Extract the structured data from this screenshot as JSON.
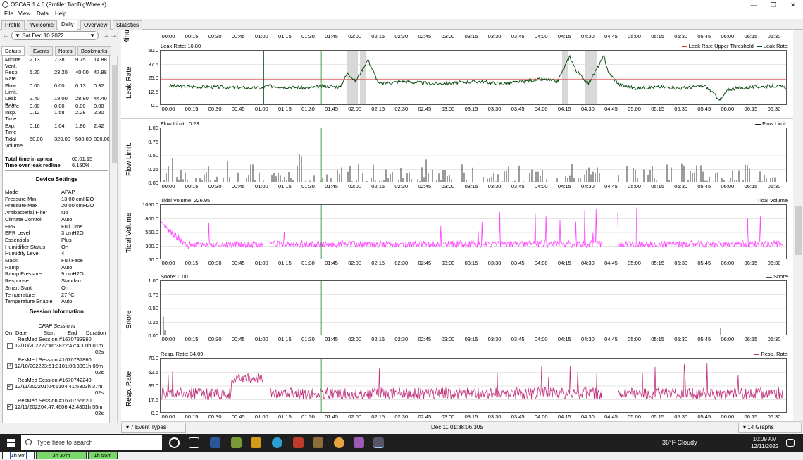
{
  "window": {
    "title": "OSCAR 1.4.0 (Profile: TwoBigWheels)"
  },
  "menu": [
    "File",
    "View",
    "Data",
    "Help"
  ],
  "tabs": [
    "Profile",
    "Welcome",
    "Daily",
    "Overview",
    "Statistics"
  ],
  "nav": {
    "date": "Sat Dec 10 2022",
    "prev": "←",
    "next": "→",
    "last": "→|"
  },
  "subtabs": [
    "Details",
    "Events",
    "Notes",
    "Bookmarks"
  ],
  "stats": [
    {
      "label": "Minute Vent.",
      "v": [
        "2.13",
        "7.38",
        "9.75",
        "14.88"
      ]
    },
    {
      "label": "Resp. Rate",
      "v": [
        "5.20",
        "23.20",
        "40.00",
        "47.88"
      ]
    },
    {
      "label": "Flow Limit.",
      "v": [
        "0.00",
        "0.00",
        "0.13",
        "0.32"
      ]
    },
    {
      "label": "Leak Rate",
      "v": [
        "2.40",
        "18.00",
        "28.80",
        "44.40"
      ]
    },
    {
      "label": "Snore",
      "v": [
        "0.00",
        "0.00",
        "0.00",
        "0.00"
      ]
    },
    {
      "label": "Insp. Time",
      "v": [
        "0.12",
        "1.58",
        "2.28",
        "2.80"
      ]
    },
    {
      "label": "Exp. Time",
      "v": [
        "0.16",
        "1.04",
        "1.86",
        "2.42"
      ]
    },
    {
      "label": "Tidal Volume",
      "v": [
        "60.00",
        "320.00",
        "500.00",
        "800.00"
      ]
    }
  ],
  "totals": [
    {
      "label": "Total time in apnea",
      "value": "00:01:15"
    },
    {
      "label": "Time over leak redline",
      "value": "6.150%"
    }
  ],
  "device_settings_title": "Device Settings",
  "settings": [
    {
      "k": "Mode",
      "v": "APAP"
    },
    {
      "k": "Pressure Min",
      "v": "13.00 cmH2O"
    },
    {
      "k": "Pressure Max",
      "v": "20.00 cmH2O"
    },
    {
      "k": "Antibacterial Filter",
      "v": "No"
    },
    {
      "k": "Climate Control",
      "v": "Auto"
    },
    {
      "k": "EPR",
      "v": "Full Time"
    },
    {
      "k": "EPR Level",
      "v": "3 cmH2O"
    },
    {
      "k": "Essentials",
      "v": "Plus"
    },
    {
      "k": "Humidifier Status",
      "v": "On"
    },
    {
      "k": "Humidity Level",
      "v": "4"
    },
    {
      "k": "Mask",
      "v": "Full Face"
    },
    {
      "k": "Ramp",
      "v": "Auto"
    },
    {
      "k": "Ramp Pressure",
      "v": "9 cmH2O"
    },
    {
      "k": "Response",
      "v": "Standard"
    },
    {
      "k": "Smart Start",
      "v": "On"
    },
    {
      "k": "Temperature",
      "v": "27 ºC"
    },
    {
      "k": "Temperature Enable",
      "v": "Auto"
    }
  ],
  "session_info_title": "Session Information",
  "cpap_sessions_label": "CPAP Sessions",
  "session_headers": [
    "On",
    "Date",
    "Start",
    "End",
    "Duration"
  ],
  "sessions": [
    {
      "name": "ResMed Session #1670733960",
      "line": "12/10/202222:46:3822:47:4000h 01m",
      "sec": "02s",
      "on": false
    },
    {
      "name": "ResMed Session #1670737860",
      "line": "12/10/202223:51:3101:00:3301h 09m",
      "sec": "02s",
      "on": true
    },
    {
      "name": "ResMed Session #1670742240",
      "line": "12/11/202201:04:5104:41:5303h 37m",
      "sec": "02s",
      "on": true
    },
    {
      "name": "ResMed Session #1670755620",
      "line": "12/11/202204:47:4606:42:4801h 55m",
      "sec": "02s",
      "on": true
    }
  ],
  "bottom_segments": [
    "1h 9m",
    "3h 37m",
    "1h 55m"
  ],
  "time_ticks": [
    "00:00",
    "00:15",
    "00:30",
    "00:45",
    "01:00",
    "01:15",
    "01:30",
    "01:45",
    "02:00",
    "02:15",
    "02:30",
    "02:45",
    "03:00",
    "03:15",
    "03:30",
    "03:45",
    "04:00",
    "04:15",
    "04:30",
    "04:45",
    "05:00",
    "05:15",
    "05:30",
    "05:45",
    "06:00",
    "06:15",
    "06:30"
  ],
  "cursor_time": "Dec 11 01:38:06.305",
  "event_types": "7 Event Types",
  "graph_count": "14 Graphs",
  "minu_label": "Minu",
  "colors": {
    "leak": "#0e4d12",
    "flow": "#222222",
    "tidal": "#ff44ff",
    "snore": "#444444",
    "resp": "#c0307a",
    "threshold": "#e04040",
    "cursor": "#1a8a1a",
    "shade": "#d8d8d8"
  },
  "chart_data": [
    {
      "type": "line",
      "title": "Leak Rate: 16.80",
      "ylabel": "Leak Rate",
      "ylim": [
        0,
        50
      ],
      "yticks": [
        "50.0",
        "37.5",
        "25.0",
        "12.5",
        "0.0"
      ],
      "legend": [
        "Leak Rate Upper Threshold",
        "Leak Rate"
      ],
      "threshold": 24,
      "x": [
        0,
        60,
        63,
        90,
        100,
        110,
        115,
        120,
        128,
        135,
        150,
        170,
        185,
        200,
        215,
        240,
        250,
        258,
        262,
        270,
        280,
        283,
        290,
        300,
        315,
        330,
        345,
        355,
        360,
        375,
        390,
        400,
        402
      ],
      "y": [
        18,
        16,
        18,
        16,
        18,
        17,
        30,
        22,
        42,
        20,
        22,
        20,
        21,
        22,
        20,
        24,
        22,
        45,
        32,
        20,
        45,
        30,
        19,
        16,
        17,
        16,
        18,
        5,
        15,
        17,
        18,
        16,
        20
      ]
    },
    {
      "type": "bar",
      "title": "Flow Limit.: 0.23",
      "ylabel": "Flow Limit.",
      "ylim": [
        0,
        1
      ],
      "yticks": [
        "1.00",
        "0.75",
        "0.50",
        "0.25",
        "0.00"
      ],
      "legend": [
        "Flow Limit."
      ],
      "typical_range": [
        0,
        0.35
      ]
    },
    {
      "type": "line",
      "title": "Tidal Volume: 226.95",
      "ylabel": "Tidal Volume",
      "ylim": [
        50,
        1050
      ],
      "yticks": [
        "1050.0",
        "800.0",
        "550.0",
        "300.0",
        "50.0"
      ],
      "legend": [
        "Tidal Volume"
      ],
      "typical_range": [
        250,
        500
      ]
    },
    {
      "type": "bar",
      "title": "Snore: 0.00",
      "ylabel": "Snore",
      "ylim": [
        0,
        1
      ],
      "yticks": [
        "1.00",
        "0.75",
        "0.50",
        "0.25",
        "0.00"
      ],
      "legend": [
        "Snore"
      ]
    },
    {
      "type": "line",
      "title": "Resp. Rate: 34.09",
      "ylabel": "Resp. Rate",
      "ylim": [
        0,
        70
      ],
      "yticks": [
        "70.0",
        "52.5",
        "35.0",
        "17.5",
        "0.0"
      ],
      "legend": [
        "Resp. Rate"
      ],
      "typical_range": [
        15,
        45
      ]
    }
  ],
  "taskbar": {
    "search_placeholder": "Type here to search",
    "weather": "36°F  Cloudy",
    "time": "10:09 AM",
    "date": "12/11/2022"
  }
}
